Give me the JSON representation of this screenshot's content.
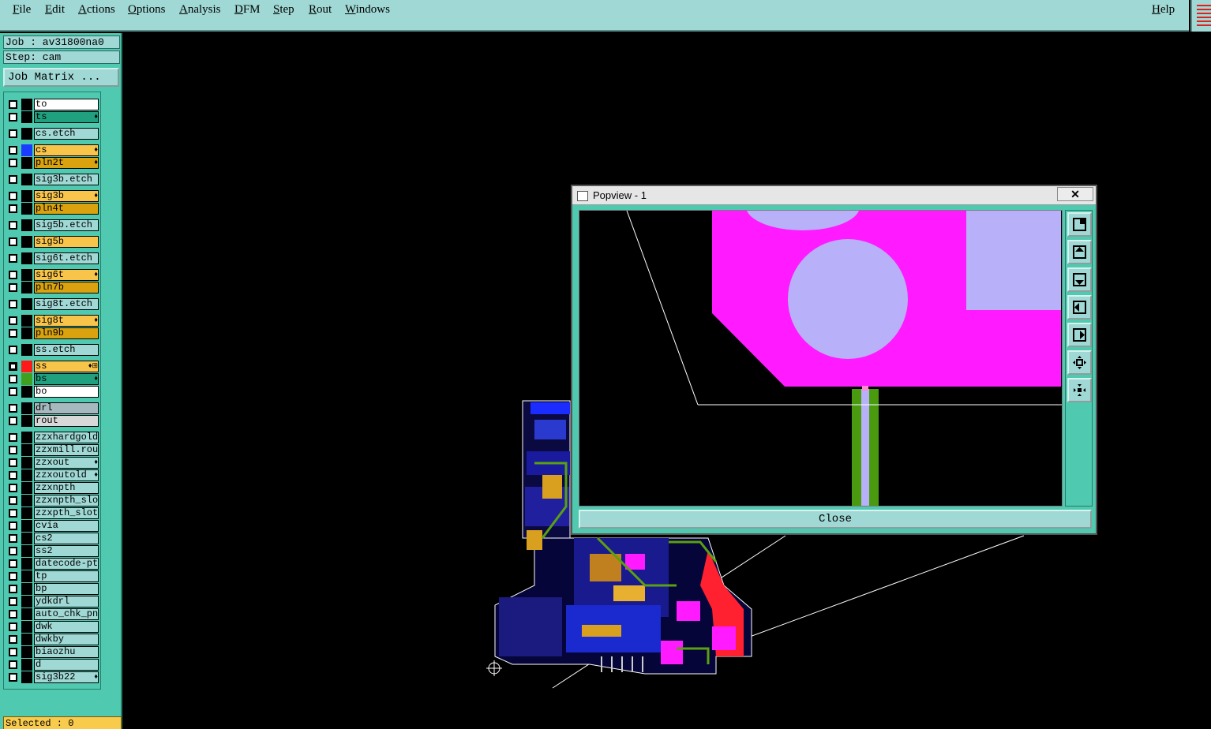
{
  "menubar": {
    "items": [
      "File",
      "Edit",
      "Actions",
      "Options",
      "Analysis",
      "DFM",
      "Step",
      "Rout",
      "Windows"
    ],
    "help": "Help"
  },
  "leftpanel": {
    "job": "Job : av31800na0",
    "step": "Step: cam",
    "job_matrix_button": "Job Matrix ...",
    "selected": "Selected : 0"
  },
  "layers": [
    {
      "name": "to",
      "bg": "#ffffff",
      "swatch": "#000000",
      "mark": ""
    },
    {
      "name": "ts",
      "bg": "#21a080",
      "swatch": "#000000",
      "mark": "♦"
    },
    {
      "name": "cs.etch",
      "bg": "#9fd8d4",
      "swatch": "#000000",
      "mark": ""
    },
    {
      "name": "cs",
      "bg": "#f8c44a",
      "swatch": "#1a3cff",
      "mark": "♦"
    },
    {
      "name": "pln2t",
      "bg": "#d9a20e",
      "swatch": "#000000",
      "mark": "♦"
    },
    {
      "name": "sig3b.etch",
      "bg": "#9fd8d4",
      "swatch": "#000000",
      "mark": ""
    },
    {
      "name": "sig3b",
      "bg": "#f8c44a",
      "swatch": "#000000",
      "mark": "♦"
    },
    {
      "name": "pln4t",
      "bg": "#d9a20e",
      "swatch": "#000000",
      "mark": ""
    },
    {
      "name": "sig5b.etch",
      "bg": "#9fd8d4",
      "swatch": "#000000",
      "mark": ""
    },
    {
      "name": "sig5b",
      "bg": "#f8c44a",
      "swatch": "#000000",
      "mark": ""
    },
    {
      "name": "sig6t.etch",
      "bg": "#9fd8d4",
      "swatch": "#000000",
      "mark": ""
    },
    {
      "name": "sig6t",
      "bg": "#f8c44a",
      "swatch": "#000000",
      "mark": "♦"
    },
    {
      "name": "pln7b",
      "bg": "#d9a20e",
      "swatch": "#000000",
      "mark": ""
    },
    {
      "name": "sig8t.etch",
      "bg": "#9fd8d4",
      "swatch": "#000000",
      "mark": ""
    },
    {
      "name": "sig8t",
      "bg": "#f8c44a",
      "swatch": "#000000",
      "mark": "♦"
    },
    {
      "name": "pln9b",
      "bg": "#d9a20e",
      "swatch": "#000000",
      "mark": ""
    },
    {
      "name": "ss.etch",
      "bg": "#9fd8d4",
      "swatch": "#000000",
      "mark": ""
    },
    {
      "name": "ss",
      "bg": "#f8c44a",
      "swatch": "#ff1a1a",
      "mark": "♦⊞",
      "checked": true
    },
    {
      "name": "bs",
      "bg": "#21a080",
      "swatch": "#3f9f1f",
      "mark": "♦"
    },
    {
      "name": "bo",
      "bg": "#ffffff",
      "swatch": "#000000",
      "mark": ""
    },
    {
      "name": "drl",
      "bg": "#a6b9bf",
      "swatch": "#000000",
      "mark": ""
    },
    {
      "name": "rout",
      "bg": "#d8d8d8",
      "swatch": "#000000",
      "mark": ""
    },
    {
      "name": "zzxhardgold",
      "bg": "#9fd8d4",
      "swatch": "#000000",
      "mark": ""
    },
    {
      "name": "zzxmill.rou",
      "bg": "#9fd8d4",
      "swatch": "#000000",
      "mark": ""
    },
    {
      "name": "zzxout",
      "bg": "#9fd8d4",
      "swatch": "#000000",
      "mark": "♦"
    },
    {
      "name": "zzxoutold",
      "bg": "#9fd8d4",
      "swatch": "#000000",
      "mark": "♦"
    },
    {
      "name": "zzxnpth",
      "bg": "#9fd8d4",
      "swatch": "#000000",
      "mark": ""
    },
    {
      "name": "zzxnpth_slot",
      "bg": "#9fd8d4",
      "swatch": "#000000",
      "mark": ""
    },
    {
      "name": "zzxpth_slots",
      "bg": "#9fd8d4",
      "swatch": "#000000",
      "mark": ""
    },
    {
      "name": "cvia",
      "bg": "#9fd8d4",
      "swatch": "#000000",
      "mark": ""
    },
    {
      "name": "cs2",
      "bg": "#9fd8d4",
      "swatch": "#000000",
      "mark": ""
    },
    {
      "name": "ss2",
      "bg": "#9fd8d4",
      "swatch": "#000000",
      "mark": ""
    },
    {
      "name": "datecode-ptc",
      "bg": "#9fd8d4",
      "swatch": "#000000",
      "mark": ""
    },
    {
      "name": "tp",
      "bg": "#9fd8d4",
      "swatch": "#000000",
      "mark": ""
    },
    {
      "name": "bp",
      "bg": "#9fd8d4",
      "swatch": "#000000",
      "mark": ""
    },
    {
      "name": "ydkdrl",
      "bg": "#9fd8d4",
      "swatch": "#000000",
      "mark": ""
    },
    {
      "name": "auto_chk_pn.",
      "bg": "#9fd8d4",
      "swatch": "#000000",
      "mark": ""
    },
    {
      "name": "dwk",
      "bg": "#9fd8d4",
      "swatch": "#000000",
      "mark": ""
    },
    {
      "name": "dwkby",
      "bg": "#9fd8d4",
      "swatch": "#000000",
      "mark": ""
    },
    {
      "name": "biaozhu",
      "bg": "#9fd8d4",
      "swatch": "#000000",
      "mark": ""
    },
    {
      "name": "d",
      "bg": "#9fd8d4",
      "swatch": "#000000",
      "mark": ""
    },
    {
      "name": "sig3b22",
      "bg": "#9fd8d4",
      "swatch": "#000000",
      "mark": "♦"
    }
  ],
  "popview": {
    "title": "Popview - 1",
    "close_x": "✕",
    "close_button": "Close",
    "tools": [
      "fit-screen-icon",
      "pan-up-icon",
      "pan-down-icon",
      "pan-left-icon",
      "pan-right-icon",
      "zoom-in-icon",
      "zoom-out-icon"
    ]
  },
  "colors": {
    "panel": "#4fcab0",
    "menubar": "#9fd8d4",
    "copper_pad": "#ff1aff",
    "drill": "#b8b0f8",
    "trace": "#4a9a10"
  }
}
